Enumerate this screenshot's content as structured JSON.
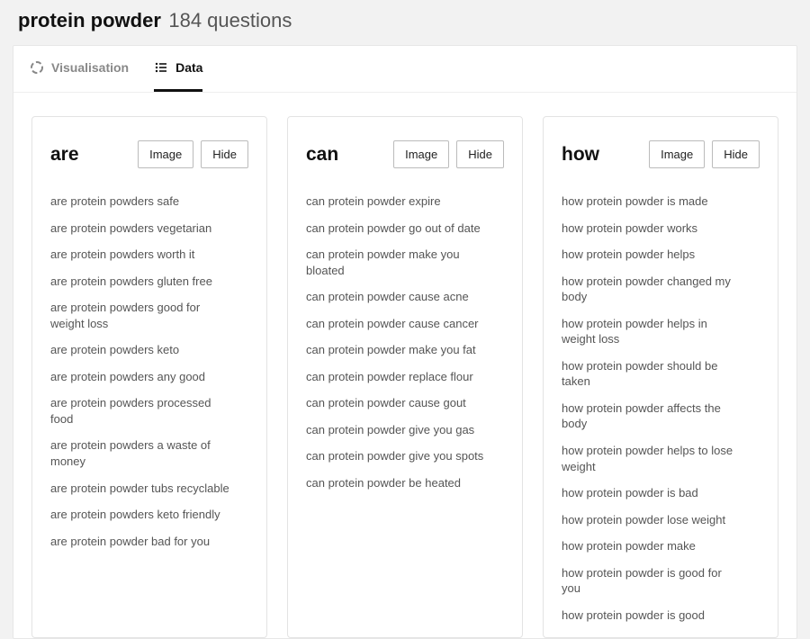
{
  "header": {
    "keyword": "protein powder",
    "count_label": "184 questions"
  },
  "tabs": {
    "visualisation": "Visualisation",
    "data": "Data"
  },
  "buttons": {
    "image": "Image",
    "hide": "Hide"
  },
  "columns": [
    {
      "title": "are",
      "items": [
        "are protein powders safe",
        "are protein powders vegetarian",
        "are protein powders worth it",
        "are protein powders gluten free",
        "are protein powders good for weight loss",
        "are protein powders keto",
        "are protein powders any good",
        "are protein powders processed food",
        "are protein powders a waste of money",
        "are protein powder tubs recyclable",
        "are protein powders keto friendly",
        "are protein powder bad for you"
      ]
    },
    {
      "title": "can",
      "items": [
        "can protein powder expire",
        "can protein powder go out of date",
        "can protein powder make you bloated",
        "can protein powder cause acne",
        "can protein powder cause cancer",
        "can protein powder make you fat",
        "can protein powder replace flour",
        "can protein powder cause gout",
        "can protein powder give you gas",
        "can protein powder give you spots",
        "can protein powder be heated"
      ]
    },
    {
      "title": "how",
      "items": [
        "how protein powder is made",
        "how protein powder works",
        "how protein powder helps",
        "how protein powder changed my body",
        "how protein powder helps in weight loss",
        "how protein powder should be taken",
        "how protein powder affects the body",
        "how protein powder helps to lose weight",
        "how protein powder is bad",
        "how protein powder lose weight",
        "how protein powder make",
        "how protein powder is good for you",
        "how protein powder is good"
      ]
    }
  ]
}
